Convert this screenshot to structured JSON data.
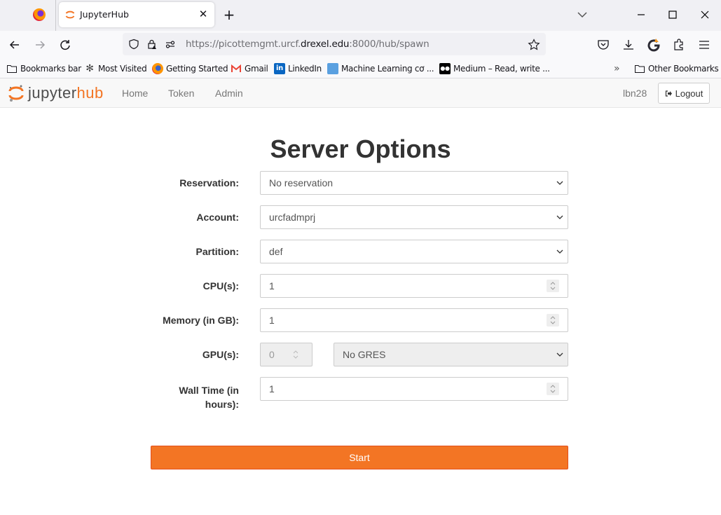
{
  "browser": {
    "tab": {
      "title": "JupyterHub"
    },
    "url": {
      "prefix": "https://picottemgmt.urcf.",
      "host": "drexel.edu",
      "suffix": ":8000/hub/spawn"
    },
    "bookmarks": [
      {
        "label": "Bookmarks bar",
        "icon": "folder-icon"
      },
      {
        "label": "Most Visited",
        "icon": "gear-icon"
      },
      {
        "label": "Getting Started",
        "icon": "firefox-icon"
      },
      {
        "label": "Gmail",
        "icon": "gmail-icon"
      },
      {
        "label": "LinkedIn",
        "icon": "linkedin-icon"
      },
      {
        "label": "Machine Learning cơ ...",
        "icon": "ml-icon"
      },
      {
        "label": "Medium – Read, write ...",
        "icon": "medium-icon"
      }
    ],
    "other_bookmarks": "Other Bookmarks",
    "overflow": "»"
  },
  "hub": {
    "logo": {
      "part1": "jupyter",
      "part2": "hub"
    },
    "nav": [
      "Home",
      "Token",
      "Admin"
    ],
    "user": "lbn28",
    "logout": "Logout"
  },
  "form": {
    "title": "Server Options",
    "reservation": {
      "label": "Reservation:",
      "value": "No reservation"
    },
    "account": {
      "label": "Account:",
      "value": "urcfadmprj"
    },
    "partition": {
      "label": "Partition:",
      "value": "def"
    },
    "cpus": {
      "label": "CPU(s):",
      "value": "1"
    },
    "memory": {
      "label": "Memory (in GB):",
      "value": "1"
    },
    "gpus": {
      "label": "GPU(s):",
      "value": "0",
      "gres": "No GRES"
    },
    "walltime": {
      "label_line1": "Wall Time (in",
      "label_line2": "hours):",
      "value": "1"
    },
    "start": "Start"
  },
  "colors": {
    "accent": "#f37524",
    "accent_border": "#e34e1c"
  }
}
